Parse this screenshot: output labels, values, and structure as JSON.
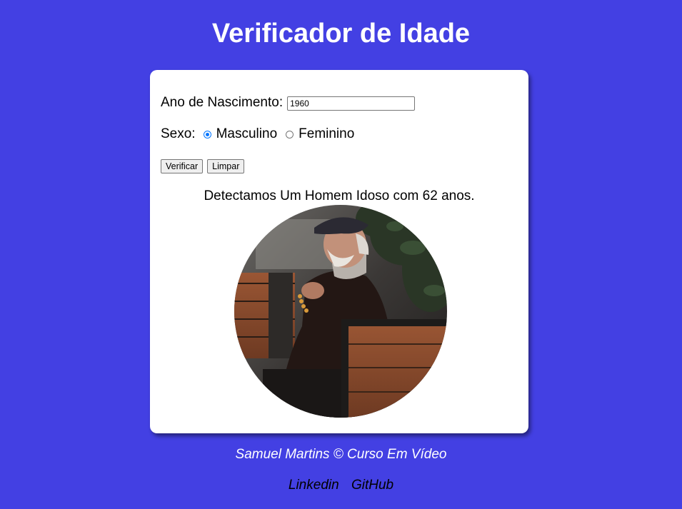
{
  "header": {
    "title": "Verificador de Idade"
  },
  "form": {
    "ano_label": "Ano de Nascimento:",
    "ano_value": "1960",
    "sexo_label": "Sexo:",
    "sexo_options": [
      "Masculino",
      "Feminino"
    ],
    "sexo_selected": "Masculino",
    "verificar_label": "Verificar",
    "limpar_label": "Limpar"
  },
  "result": {
    "text": "Detectamos Um Homem Idoso com 62 anos.",
    "image": "elderly-man-photo"
  },
  "footer": {
    "credit": "Samuel Martins © Curso Em Vídeo",
    "links": [
      "Linkedin",
      "GitHub"
    ]
  },
  "colors": {
    "background": "#4340e3",
    "card": "#ffffff",
    "radio_accent": "#0075ff"
  }
}
